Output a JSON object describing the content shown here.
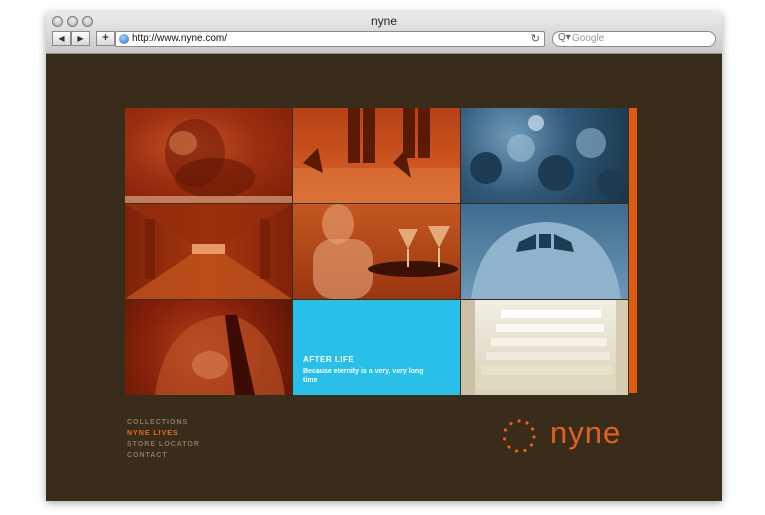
{
  "window": {
    "title": "nyne",
    "url": "http://www.nyne.com/",
    "search_placeholder": "Google",
    "back_glyph": "◀",
    "forward_glyph": "▶",
    "add_glyph": "+",
    "reload_glyph": "↻",
    "search_glyph": "Q▾"
  },
  "grid": {
    "tiles": [
      {
        "image": "dog-photo"
      },
      {
        "image": "legs-heels-photo"
      },
      {
        "image": "crowd-photo"
      },
      {
        "image": "hallway-photo"
      },
      {
        "image": "waitress-martini-photo"
      },
      {
        "image": "airplane-nose-photo"
      },
      {
        "image": "man-tie-photo"
      },
      {
        "image": "after-life-feature"
      },
      {
        "image": "white-stairs-photo"
      }
    ],
    "feature": {
      "title": "AFTER LIFE",
      "text": "Because eternity is a very, very long time"
    }
  },
  "nav": {
    "items": [
      "COLLECTIONS",
      "NYNE LIVES",
      "STORE LOCATOR",
      "CONTACT"
    ],
    "active_index": 1
  },
  "logo": {
    "text": "nyne"
  },
  "colors": {
    "background": "#3a2c1a",
    "accent": "#e0611a",
    "feature_blue": "#28c0e8",
    "nav_text": "#8a7a63"
  }
}
